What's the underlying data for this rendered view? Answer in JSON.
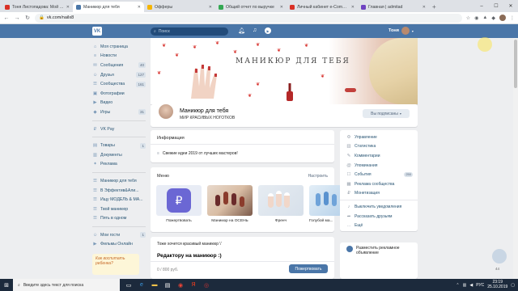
{
  "browser": {
    "tabs": [
      {
        "title": "Тоня Листопадова: Мой пр...",
        "color": "#d93025"
      },
      {
        "title": "Маникюр для тебя",
        "color": "#4a76a8",
        "active": true
      },
      {
        "title": "Офферы",
        "color": "#f4b400"
      },
      {
        "title": "Общий отчет по выручке",
        "color": "#34a853"
      },
      {
        "title": "Личный кабинет e-Comme...",
        "color": "#d93025"
      },
      {
        "title": "Главная | admitad",
        "color": "#6f42c1"
      }
    ],
    "new_tab": "+",
    "url": "vk.com/nailx8"
  },
  "vk_header": {
    "logo": "VK",
    "search_placeholder": "Поиск",
    "user_name": "Тоня"
  },
  "sidebar": {
    "items": [
      {
        "icon": "⌂",
        "label": "Моя страница",
        "count": ""
      },
      {
        "icon": "≡",
        "label": "Новости",
        "count": ""
      },
      {
        "icon": "✉",
        "label": "Сообщения",
        "count": "40"
      },
      {
        "icon": "☺",
        "label": "Друзья",
        "count": "127"
      },
      {
        "icon": "☰",
        "label": "Сообщества",
        "count": "161"
      },
      {
        "icon": "▣",
        "label": "Фотографии",
        "count": ""
      },
      {
        "icon": "▶",
        "label": "Видео",
        "count": ""
      },
      {
        "icon": "◆",
        "label": "Игры",
        "count": "31"
      }
    ],
    "items2": [
      {
        "icon": "₽",
        "label": "VK Pay",
        "count": ""
      }
    ],
    "items3": [
      {
        "icon": "▤",
        "label": "Товары",
        "count": "1"
      },
      {
        "icon": "▥",
        "label": "Документы",
        "count": ""
      },
      {
        "icon": "✦",
        "label": "Реклама",
        "count": ""
      }
    ],
    "items4": [
      {
        "icon": "☰",
        "label": "Маникюр для тебя",
        "count": ""
      },
      {
        "icon": "☰",
        "label": "В Эффектив&Али...",
        "count": ""
      },
      {
        "icon": "☰",
        "label": "Ищу МОДЕЛЬ & МА...",
        "count": ""
      },
      {
        "icon": "☰",
        "label": "Твой маникюр",
        "count": ""
      },
      {
        "icon": "☰",
        "label": "Пять в одном",
        "count": ""
      }
    ],
    "items5": [
      {
        "icon": "☺",
        "label": "Мои гости",
        "count": "1"
      },
      {
        "icon": "▶",
        "label": "Фильмы Онлайн",
        "count": ""
      }
    ],
    "promo_text": "Как воспитать ребенка?"
  },
  "cover": {
    "title": "МАНИКЮР ДЛЯ ТЕБЯ"
  },
  "profile": {
    "name": "Маникюр для тебя",
    "status": "МИР КРАСИВЫХ НОГОТКОВ",
    "subscribe": "Вы подписаны"
  },
  "info": {
    "heading": "Информация",
    "text": "Свежие идеи 2019 от лучших мастеров!"
  },
  "menu": {
    "heading": "Меню",
    "edit": "Настроить",
    "items": [
      {
        "label": "Пожертвовать"
      },
      {
        "label": "Маникюр на ОСЕНЬ"
      },
      {
        "label": "Френч"
      },
      {
        "label": "Голубой ма..."
      }
    ]
  },
  "post": {
    "question": "Тоже хочется красивый маникюр \\'",
    "title": "Редактору на маникюр :)",
    "counter": "0 / 800 руб.",
    "publish": "Пожертвовать"
  },
  "management": {
    "items": [
      {
        "icon": "⚙",
        "label": "Управление",
        "badge": ""
      },
      {
        "icon": "▥",
        "label": "Статистика",
        "badge": ""
      },
      {
        "icon": "✎",
        "label": "Комментарии",
        "badge": ""
      },
      {
        "icon": "@",
        "label": "Упоминания",
        "badge": ""
      },
      {
        "icon": "☐",
        "label": "События",
        "badge": "250"
      },
      {
        "icon": "▦",
        "label": "Реклама сообщества",
        "badge": ""
      },
      {
        "icon": "₽",
        "label": "Монетизация",
        "badge": ""
      }
    ],
    "items2": [
      {
        "icon": "♪",
        "label": "Выключить уведомления",
        "badge": ""
      },
      {
        "icon": "➦",
        "label": "Рассказать друзьям",
        "badge": ""
      },
      {
        "icon": "…",
        "label": "Ещё",
        "badge": ""
      }
    ]
  },
  "ad": {
    "text1": "Разместить рекламное",
    "text2": "объявление"
  },
  "messenger": {
    "count": "44"
  },
  "taskbar": {
    "search_placeholder": "Введите здесь текст для поиска",
    "lang": "РУС",
    "time": "23:19",
    "date": "25.10.2019"
  }
}
